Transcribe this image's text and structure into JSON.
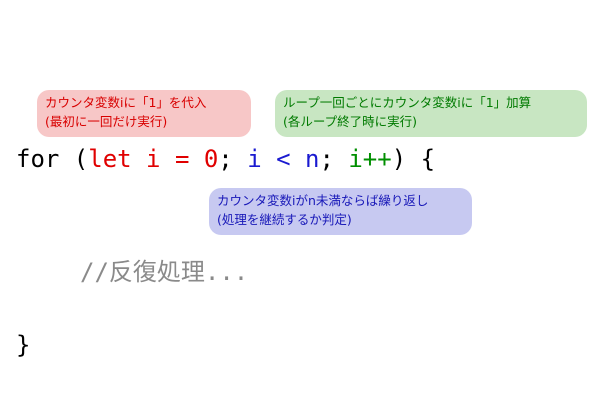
{
  "annotations": {
    "init": {
      "line1": "カウンタ変数iに「1」を代入",
      "line2": "(最初に一回だけ実行)",
      "color": "#d80000",
      "background": "#f7c7c7"
    },
    "increment": {
      "line1": "ループ一回ごとにカウンタ変数iに「1」加算",
      "line2": "(各ループ終了時に実行)",
      "color": "#007a00",
      "background": "#c8e6c2"
    },
    "condition": {
      "line1": "カウンタ変数iがn未満ならば繰り返し",
      "line2": "(処理を継続するか判定)",
      "color": "#1818b8",
      "background": "#c7c9f1"
    }
  },
  "code": {
    "for_keyword": "for (",
    "init_part": "let i = 0",
    "sep1": "; ",
    "cond_part": "i < n",
    "sep2": "; ",
    "incr_part": "i++",
    "close_paren": ") {",
    "comment": "//反復処理...",
    "closing_brace": "}"
  }
}
